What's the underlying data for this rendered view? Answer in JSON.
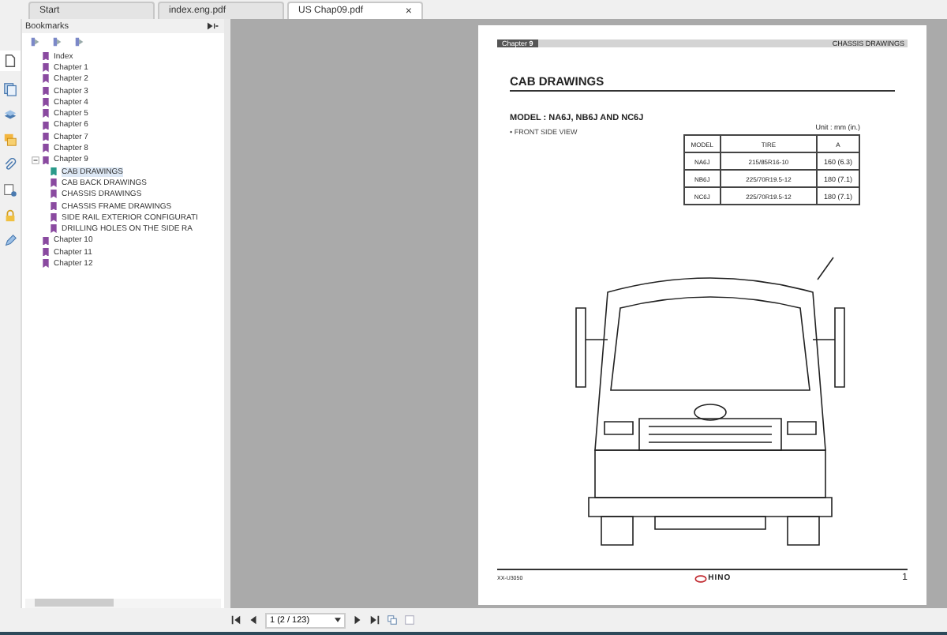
{
  "tabs": [
    {
      "label": "Start",
      "selected": false
    },
    {
      "label": "index.eng.pdf",
      "selected": false
    },
    {
      "label": "US Chap09.pdf",
      "selected": true,
      "close": "×"
    }
  ],
  "bookmarks": {
    "title": "Bookmarks",
    "items": [
      {
        "label": "Index",
        "selected": false
      },
      {
        "label": "Chapter 1",
        "selected": false
      },
      {
        "label": "Chapter 2",
        "selected": false
      },
      {
        "label": "Chapter 3",
        "selected": false
      },
      {
        "label": "Chapter 4",
        "selected": false
      },
      {
        "label": "Chapter 5",
        "selected": false
      },
      {
        "label": "Chapter 6",
        "selected": false
      },
      {
        "label": "Chapter 7",
        "selected": false
      },
      {
        "label": "Chapter 8",
        "selected": false
      },
      {
        "label": "Chapter 9",
        "selected": false,
        "expanded": true,
        "children": [
          {
            "label": "CAB DRAWINGS",
            "selected": true
          },
          {
            "label": "CAB BACK DRAWINGS",
            "selected": false
          },
          {
            "label": "CHASSIS DRAWINGS",
            "selected": false
          },
          {
            "label": "CHASSIS FRAME DRAWINGS",
            "selected": false
          },
          {
            "label": "SIDE RAIL EXTERIOR CONFIGURATI",
            "selected": false
          },
          {
            "label": "DRILLING HOLES ON THE SIDE RA",
            "selected": false
          }
        ]
      },
      {
        "label": "Chapter 10",
        "selected": false
      },
      {
        "label": "Chapter 11",
        "selected": false
      },
      {
        "label": "Chapter 12",
        "selected": false
      }
    ]
  },
  "document": {
    "chapter_label": "Chapter",
    "chapter_number": "9",
    "section": "CHASSIS DRAWINGS",
    "title": "CAB DRAWINGS",
    "model": "MODEL : NA6J, NB6J AND NC6J",
    "view": "• FRONT SIDE VIEW",
    "unit": "Unit : mm (in.)",
    "table": {
      "columns": [
        "MODEL",
        "TIRE",
        "A"
      ],
      "rows": [
        [
          "NA6J",
          "215/85R16-10",
          "160 (6.3)"
        ],
        [
          "NB6J",
          "225/70R19.5-12",
          "180 (7.1)"
        ],
        [
          "NC6J",
          "225/70R19.5-12",
          "180 (7.1)"
        ]
      ]
    },
    "footer_code": "XX-U3050",
    "brand": "HINO",
    "page_number": "1"
  },
  "toolbar": {
    "page_field": "1 (2 / 123)"
  }
}
